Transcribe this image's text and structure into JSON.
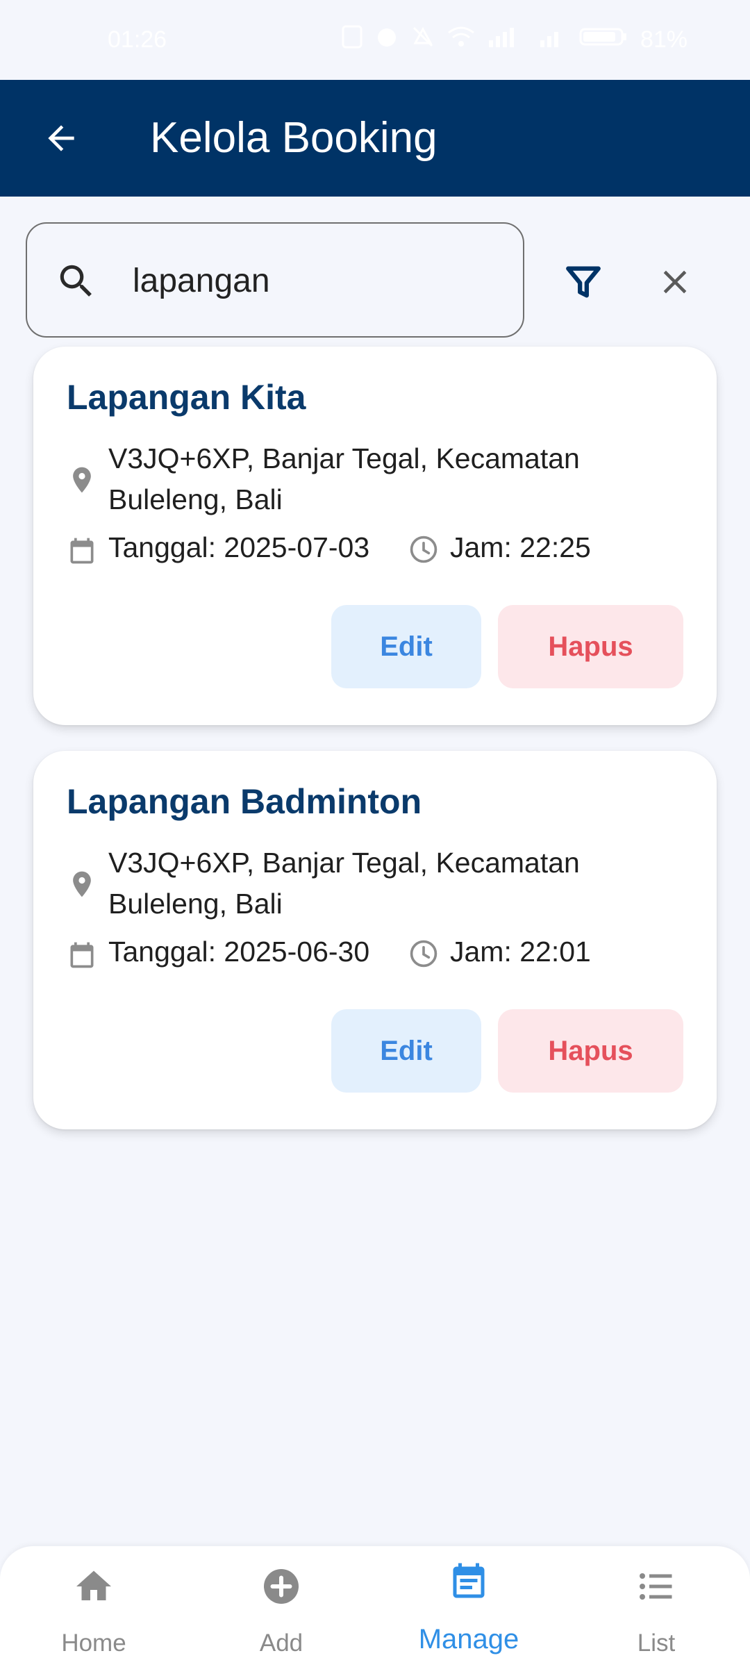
{
  "status_bar": {
    "time": "01:26",
    "battery": "81%"
  },
  "app_bar": {
    "title": "Kelola Booking"
  },
  "search": {
    "value": "lapangan"
  },
  "bookings": [
    {
      "name": "Lapangan Kita",
      "address": "V3JQ+6XP, Banjar Tegal, Kecamatan Buleleng, Bali",
      "date": "Tanggal: 2025-07-03",
      "time": "Jam: 22:25",
      "edit_label": "Edit",
      "delete_label": "Hapus"
    },
    {
      "name": "Lapangan Badminton",
      "address": "V3JQ+6XP, Banjar Tegal, Kecamatan Buleleng, Bali",
      "date": "Tanggal: 2025-06-30",
      "time": "Jam: 22:01",
      "edit_label": "Edit",
      "delete_label": "Hapus"
    }
  ],
  "bottom_nav": {
    "items": [
      {
        "label": "Home",
        "icon": "home-icon"
      },
      {
        "label": "Add",
        "icon": "add-circle-icon"
      },
      {
        "label": "Manage",
        "icon": "event-note-icon",
        "active": true
      },
      {
        "label": "List",
        "icon": "list-icon"
      }
    ]
  },
  "colors": {
    "primary": "#003366",
    "accent": "#2f8fe6",
    "edit_bg": "#e3f0fd",
    "delete_bg": "#fde7ea",
    "delete_text": "#e5505b"
  }
}
